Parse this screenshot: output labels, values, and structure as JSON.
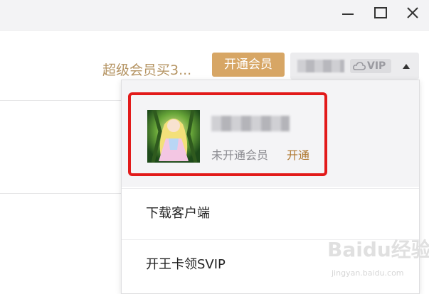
{
  "window": {
    "minimize_icon": "minimize-icon",
    "maximize_icon": "maximize-icon",
    "close_icon": "close-icon"
  },
  "header": {
    "promo_text": "超级会员买3...",
    "open_member_label": "开通会员",
    "user_name_obscured": "",
    "vip_label": "VIP",
    "dropdown_toggle_icon": "chevron-up-icon"
  },
  "dropdown": {
    "profile": {
      "name_obscured": "",
      "status": "未开通会员",
      "activate_label": "开通"
    },
    "items": [
      {
        "label": "下载客户端"
      },
      {
        "label": "开王卡领SVIP"
      }
    ]
  },
  "watermark": {
    "logo": "Baidu经验",
    "site": "jingyan.baidu.com"
  },
  "colors": {
    "accent_gold": "#d7a665",
    "promo_text": "#b59463",
    "highlight_red": "#e21a1a"
  }
}
